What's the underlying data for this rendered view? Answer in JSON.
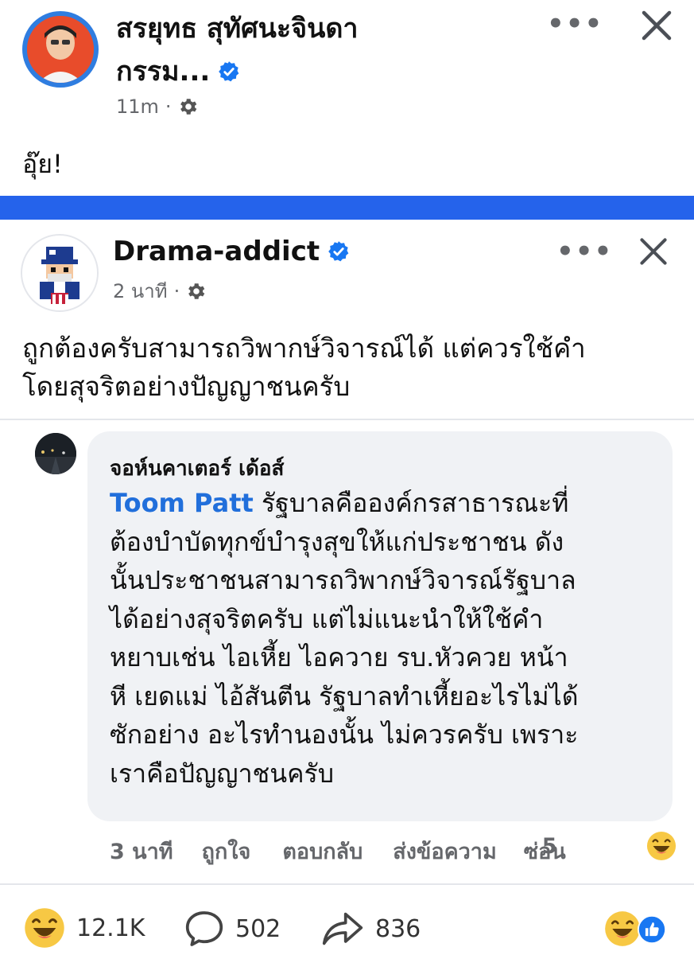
{
  "post1": {
    "author": "สรยุทธ สุทัศนะจินดา",
    "author_line2": "กรรม...",
    "time": "11m",
    "body": "อุ๊ย!"
  },
  "post2": {
    "author": "Drama-addict",
    "time": "2 นาที",
    "body_line1": "ถูกต้องครับสามารถวิพากษ์วิจารณ์ได้ แต่ควรใช้คำ",
    "body_line2": "โดยสุจริตอย่างปัญญาชนครับ"
  },
  "comment": {
    "author": "จอห์นคาเตอร์ เด้อส์",
    "mention": "Toom Patt",
    "lines": [
      " รัฐบาลคือองค์กรสาธารณะที่",
      "ต้องบำบัดทุกข์บำรุงสุขให้แก่ประชาชน ดัง",
      "นั้นประชาชนสามารถวิพากษ์วิจารณ์รัฐบาล",
      "ได้อย่างสุจริตครับ แต่ไม่แนะนำให้ใช้คำ",
      "หยาบเช่น ไอเหี้ย ไอควาย รบ.หัวควย หน้า",
      "หี เยดแม่ ไอ้สันตีน รัฐบาลทำเหี้ยอะไรไม่ได้",
      "ซักอย่าง อะไรทำนองนั้น ไม่ควรครับ เพราะ",
      "เราคือปัญญาชนครับ"
    ],
    "actions": {
      "time": "3 นาที",
      "like": "ถูกใจ",
      "reply": "ตอบกลับ",
      "message": "ส่งข้อความ",
      "hide": "ซ่อน",
      "reaction_count": "5"
    }
  },
  "footer": {
    "reactions": "12.1K",
    "comments": "502",
    "shares": "836"
  },
  "colors": {
    "accent_bar": "#2563eb",
    "verified": "#1877f2",
    "mention": "#216fdb"
  }
}
